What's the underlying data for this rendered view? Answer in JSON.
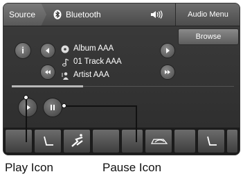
{
  "topbar": {
    "source_label": "Source",
    "bluetooth_label": "Bluetooth",
    "audio_menu_label": "Audio Menu"
  },
  "browse_label": "Browse",
  "info_label": "i",
  "track": {
    "album": "Album AAA",
    "title": "01 Track AAA",
    "artist": "Artist AAA"
  },
  "progress": {
    "fraction": 0.32
  },
  "callouts": {
    "play": "Play Icon",
    "pause": "Pause Icon"
  },
  "icons": [
    "bluetooth-icon",
    "volume-icon",
    "info-icon",
    "prev-icon",
    "next-icon",
    "skip-back-icon",
    "skip-forward-icon",
    "album-icon",
    "note-icon",
    "artist-icon",
    "play-icon",
    "pause-icon",
    "seat-icon",
    "mode-icon",
    "car-icon"
  ]
}
